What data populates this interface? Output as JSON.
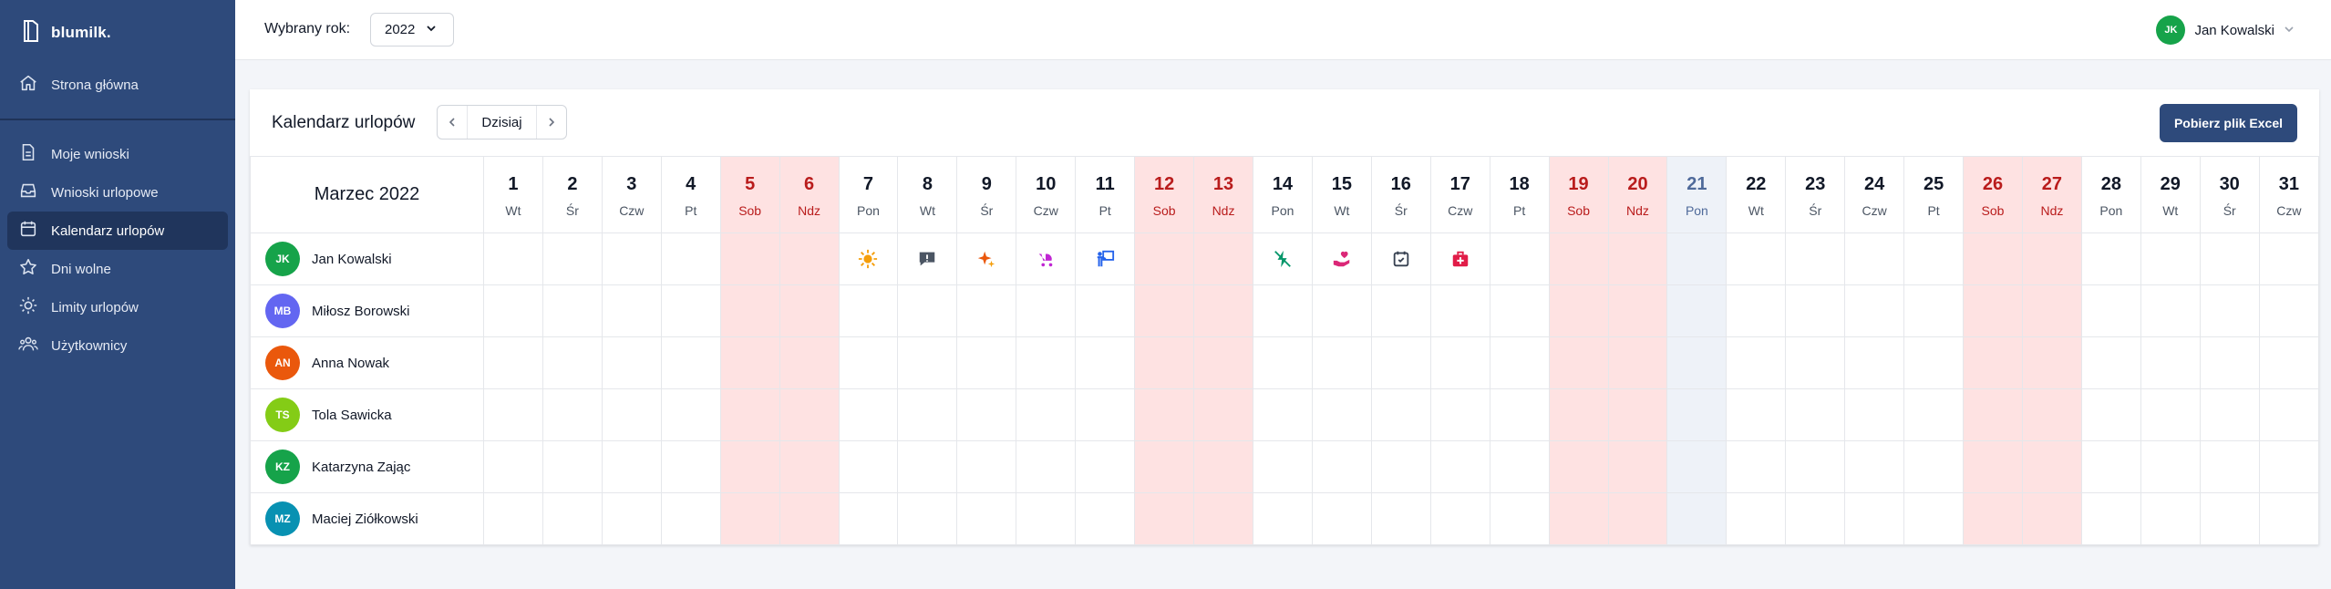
{
  "app": {
    "name": "blumilk."
  },
  "sidebar": {
    "top": [
      {
        "label": "Strona główna",
        "icon": "home-icon"
      }
    ],
    "items": [
      {
        "label": "Moje wnioski",
        "icon": "document-icon"
      },
      {
        "label": "Wnioski urlopowe",
        "icon": "inbox-icon"
      },
      {
        "label": "Kalendarz urlopów",
        "icon": "calendar-icon",
        "active": true
      },
      {
        "label": "Dni wolne",
        "icon": "star-icon"
      },
      {
        "label": "Limity urlopów",
        "icon": "sun-icon"
      },
      {
        "label": "Użytkownicy",
        "icon": "users-icon"
      }
    ]
  },
  "header": {
    "year_label": "Wybrany rok:",
    "year": "2022"
  },
  "user": {
    "name": "Jan Kowalski",
    "initials": "JK",
    "color": "#16a34a"
  },
  "calendar": {
    "title": "Kalendarz urlopów",
    "today_label": "Dzisiaj",
    "export_label": "Pobierz plik Excel",
    "month": "Marzec 2022",
    "days": [
      {
        "num": "1",
        "name": "Wt"
      },
      {
        "num": "2",
        "name": "Śr"
      },
      {
        "num": "3",
        "name": "Czw"
      },
      {
        "num": "4",
        "name": "Pt"
      },
      {
        "num": "5",
        "name": "Sob",
        "weekend": true
      },
      {
        "num": "6",
        "name": "Ndz",
        "weekend": true
      },
      {
        "num": "7",
        "name": "Pon"
      },
      {
        "num": "8",
        "name": "Wt"
      },
      {
        "num": "9",
        "name": "Śr"
      },
      {
        "num": "10",
        "name": "Czw"
      },
      {
        "num": "11",
        "name": "Pt"
      },
      {
        "num": "12",
        "name": "Sob",
        "weekend": true
      },
      {
        "num": "13",
        "name": "Ndz",
        "weekend": true
      },
      {
        "num": "14",
        "name": "Pon"
      },
      {
        "num": "15",
        "name": "Wt"
      },
      {
        "num": "16",
        "name": "Śr"
      },
      {
        "num": "17",
        "name": "Czw"
      },
      {
        "num": "18",
        "name": "Pt"
      },
      {
        "num": "19",
        "name": "Sob",
        "weekend": true
      },
      {
        "num": "20",
        "name": "Ndz",
        "weekend": true
      },
      {
        "num": "21",
        "name": "Pon",
        "today": true
      },
      {
        "num": "22",
        "name": "Wt"
      },
      {
        "num": "23",
        "name": "Śr"
      },
      {
        "num": "24",
        "name": "Czw"
      },
      {
        "num": "25",
        "name": "Pt"
      },
      {
        "num": "26",
        "name": "Sob",
        "weekend": true
      },
      {
        "num": "27",
        "name": "Ndz",
        "weekend": true
      },
      {
        "num": "28",
        "name": "Pon"
      },
      {
        "num": "29",
        "name": "Wt"
      },
      {
        "num": "30",
        "name": "Śr"
      },
      {
        "num": "31",
        "name": "Czw"
      }
    ],
    "employees": [
      {
        "name": "Jan Kowalski",
        "initials": "JK",
        "color": "#16a34a",
        "vacations": {
          "7": "sun-icon",
          "8": "chat-alert-icon",
          "9": "sparkles-icon",
          "10": "stroller-icon",
          "11": "training-icon",
          "14": "lightning-off-icon",
          "15": "heart-hand-icon",
          "16": "calendar-check-icon",
          "17": "medical-kit-icon"
        }
      },
      {
        "name": "Miłosz Borowski",
        "initials": "MB",
        "color": "#6366f1",
        "vacations": {}
      },
      {
        "name": "Anna Nowak",
        "initials": "AN",
        "color": "#ea580c",
        "vacations": {}
      },
      {
        "name": "Tola Sawicka",
        "initials": "TS",
        "color": "#84cc16",
        "vacations": {}
      },
      {
        "name": "Katarzyna Zając",
        "initials": "KZ",
        "color": "#16a34a",
        "vacations": {}
      },
      {
        "name": "Maciej Ziółkowski",
        "initials": "MZ",
        "color": "#0891b2",
        "vacations": {}
      }
    ],
    "icon_colors": {
      "sun-icon": "#f59e0b",
      "chat-alert-icon": "#4b5563",
      "sparkles-icon": "#ea580c",
      "stroller-icon": "#c026d3",
      "training-icon": "#2563eb",
      "lightning-off-icon": "#059669",
      "heart-hand-icon": "#db2777",
      "calendar-check-icon": "#374151",
      "medical-kit-icon": "#e11d48"
    }
  }
}
